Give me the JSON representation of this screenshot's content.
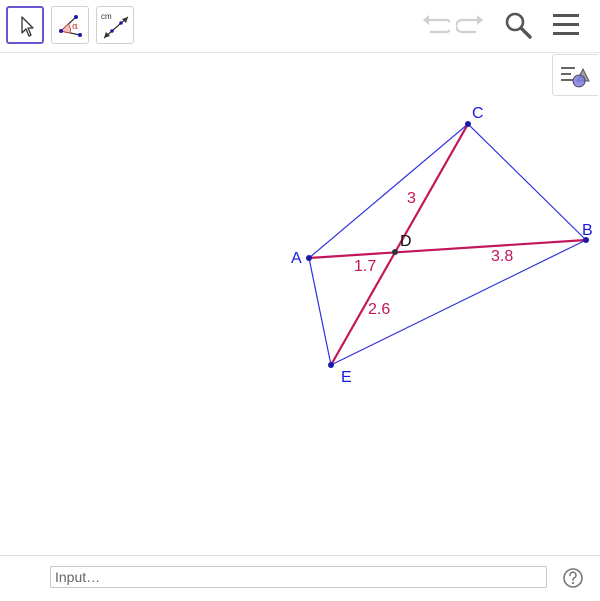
{
  "toolbar": {
    "tools": [
      {
        "name": "Move",
        "icon": "cursor-arrow-icon"
      },
      {
        "name": "Angle",
        "icon": "angle-icon",
        "glyph": "α"
      },
      {
        "name": "Distance or Length",
        "icon": "distance-icon",
        "glyph": "cm"
      }
    ],
    "actions": [
      "undo-icon",
      "redo-icon",
      "search-icon",
      "menu-icon"
    ]
  },
  "graphics": {
    "points": [
      {
        "id": "A",
        "label": "A"
      },
      {
        "id": "B",
        "label": "B"
      },
      {
        "id": "C",
        "label": "C"
      },
      {
        "id": "D",
        "label": "D"
      },
      {
        "id": "E",
        "label": "E"
      }
    ],
    "length_labels": {
      "CD": "3",
      "AD": "1.7",
      "DB": "3.8",
      "DE": "2.6"
    },
    "colors": {
      "polygon": "#2f2fe0",
      "segment": "#c2185b",
      "point": "#1a1aa8",
      "label_point": "#1a1ae0",
      "label_length": "#c2185b"
    }
  },
  "input_bar": {
    "placeholder": "Input…"
  },
  "accent": "#6557d2"
}
